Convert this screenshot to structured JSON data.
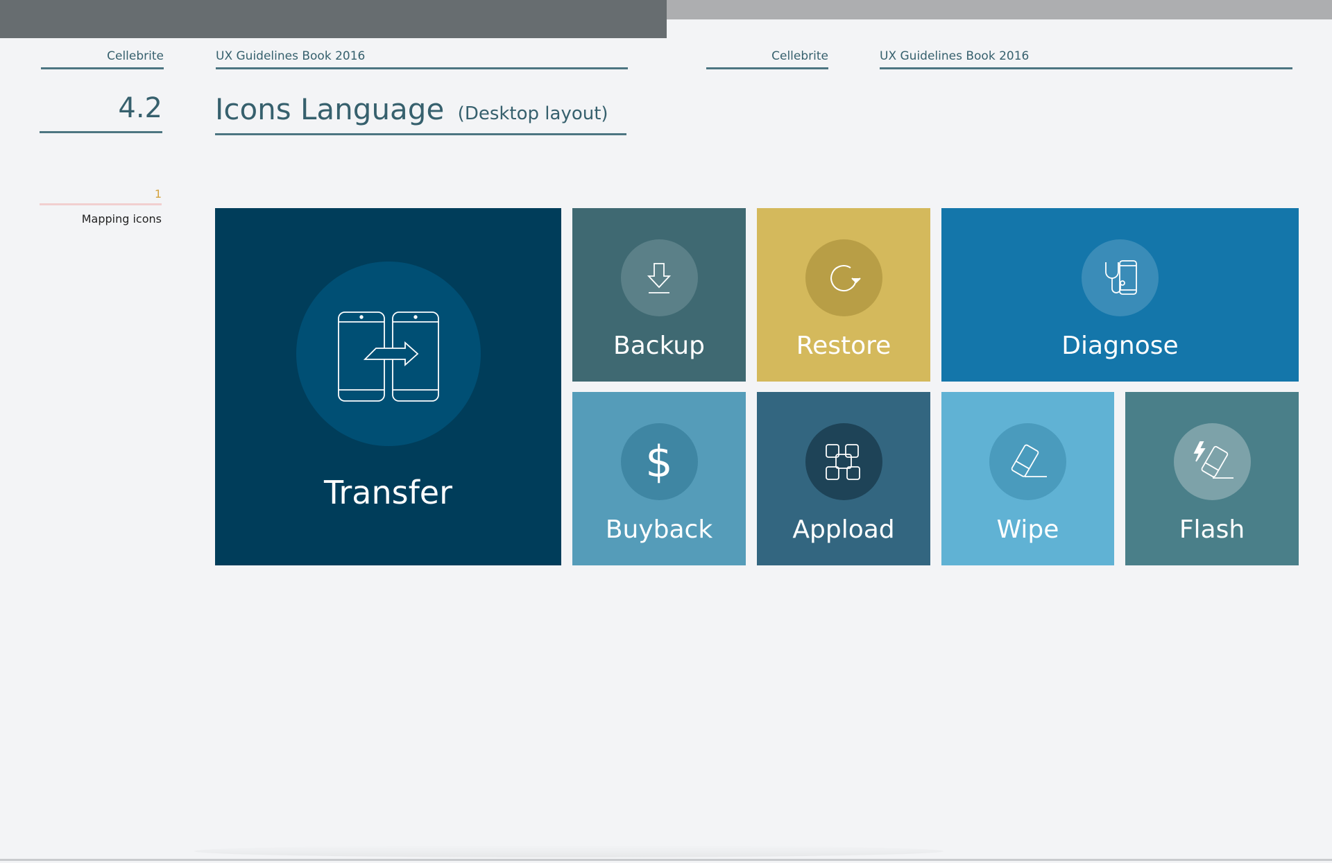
{
  "header": {
    "left_brand": "Cellebrite",
    "left_book": "UX Guidelines Book 2016",
    "right_brand": "Cellebrite",
    "right_book": "UX Guidelines Book 2016"
  },
  "section": {
    "number": "4.2",
    "title": "Icons Language",
    "subtitle": "(Desktop layout)"
  },
  "toc": {
    "item_number": "1",
    "item_label": "Mapping icons"
  },
  "tiles": [
    {
      "label": "Transfer",
      "icon": "transfer-icon",
      "color": "#003d5a",
      "circle": "#004f74"
    },
    {
      "label": "Backup",
      "icon": "download-icon",
      "color": "#3f6972",
      "circle": "#5b8088"
    },
    {
      "label": "Restore",
      "icon": "restore-icon",
      "color": "#d4b95c",
      "circle": "#b89e46"
    },
    {
      "label": "Diagnose",
      "icon": "stethoscope-phone-icon",
      "color": "#1476aa",
      "circle": "#3a8cb8"
    },
    {
      "label": "Buyback",
      "icon": "dollar-icon",
      "color": "#559cb9",
      "circle": "#3f86a3"
    },
    {
      "label": "Appload",
      "icon": "apps-icon",
      "color": "#336680",
      "circle": "#1e4357"
    },
    {
      "label": "Wipe",
      "icon": "eraser-icon",
      "color": "#60b2d4",
      "circle": "#4a9bbd"
    },
    {
      "label": "Flash",
      "icon": "flash-icon",
      "color": "#4a7f89",
      "circle": "#7da2a9"
    }
  ]
}
